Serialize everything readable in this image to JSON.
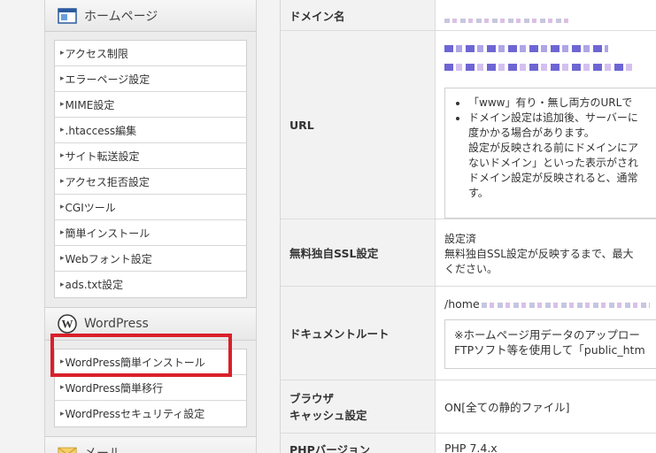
{
  "sidebar": {
    "homepage": {
      "title": "ホームページ",
      "items": [
        "アクセス制限",
        "エラーページ設定",
        "MIME設定",
        ".htaccess編集",
        "サイト転送設定",
        "アクセス拒否設定",
        "CGIツール",
        "簡単インストール",
        "Webフォント設定",
        "ads.txt設定"
      ]
    },
    "wordpress": {
      "title": "WordPress",
      "items": [
        "WordPress簡単インストール",
        "WordPress簡単移行",
        "WordPressセキュリティ設定"
      ]
    },
    "mail": {
      "title": "メール"
    }
  },
  "table": {
    "domain_label": "ドメイン名",
    "url_label": "URL",
    "url_notes": {
      "line1": "「www」有り・無し両方のURLで",
      "line2": "ドメイン設定は追加後、サーバーに",
      "line3": "度かかる場合があります。",
      "line4": "設定が反映される前にドメインにア",
      "line5": "ないドメイン」といった表示がされ",
      "line6": "ドメイン設定が反映されると、通常",
      "line7": "す。"
    },
    "ssl_label": "無料独自SSL設定",
    "ssl_status": "設定済",
    "ssl_note_1": "無料独自SSL設定が反映するまで、最大",
    "ssl_note_2": "ください。",
    "docroot_label": "ドキュメントルート",
    "docroot_prefix": "/home",
    "docroot_note_1": "※ホームページ用データのアップロー",
    "docroot_note_2": "FTPソフト等を使用して「public_htm",
    "cache_label_1": "ブラウザ",
    "cache_label_2": "キャッシュ設定",
    "cache_value": "ON[全ての静的ファイル]",
    "php_label": "PHPバージョン",
    "php_value": "PHP 7.4.x"
  },
  "colors": {
    "highlight": "#d9202a"
  }
}
